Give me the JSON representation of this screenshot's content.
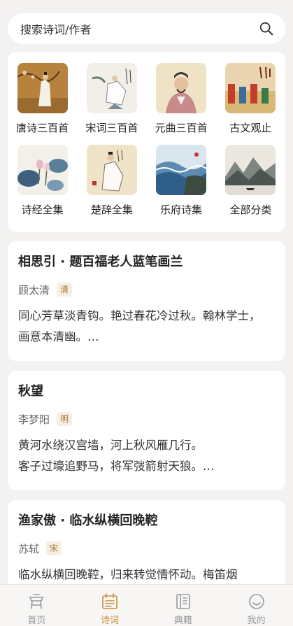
{
  "search": {
    "placeholder": "搜索诗词/作者"
  },
  "categories": [
    {
      "label": "唐诗三百首",
      "icon": "tang-painting"
    },
    {
      "label": "宋词三百首",
      "icon": "song-painting"
    },
    {
      "label": "元曲三百首",
      "icon": "yuan-painting"
    },
    {
      "label": "古文观止",
      "icon": "guwen-painting"
    },
    {
      "label": "诗经全集",
      "icon": "lotus-painting"
    },
    {
      "label": "楚辞全集",
      "icon": "scholar-painting"
    },
    {
      "label": "乐府诗集",
      "icon": "waves-painting"
    },
    {
      "label": "全部分类",
      "icon": "mountain-painting"
    }
  ],
  "poems": [
    {
      "title": "相思引 · 题百福老人蓝笔画兰",
      "author": "顾太清",
      "dynasty": "清",
      "lines": [
        "同心芳草淡青钩。艳过春花冷过秋。翰林学士，",
        "画意本清幽。…"
      ]
    },
    {
      "title": "秋望",
      "author": "李梦阳",
      "dynasty": "明",
      "lines": [
        "黄河水绕汉宫墙，河上秋风雁几行。",
        "客子过壕追野马，将军弢箭射天狼。…"
      ]
    },
    {
      "title": "渔家傲 · 临水纵横回晚鞚",
      "author": "苏轼",
      "dynasty": "宋",
      "lines": [
        "临水纵横回晚鞚，归来转觉情怀动。梅笛烟"
      ]
    }
  ],
  "tabs": [
    {
      "label": "首页",
      "icon": "home-icon",
      "active": false
    },
    {
      "label": "诗词",
      "icon": "poem-icon",
      "active": true
    },
    {
      "label": "典籍",
      "icon": "book-icon",
      "active": false
    },
    {
      "label": "我的",
      "icon": "profile-icon",
      "active": false
    }
  ],
  "colors": {
    "accent": "#c7913a",
    "background": "#f3f2f0",
    "card": "#ffffff"
  }
}
